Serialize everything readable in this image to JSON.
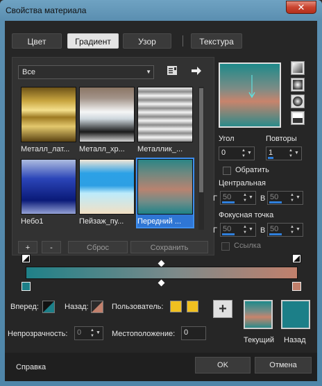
{
  "window": {
    "title": "Свойства материала",
    "close": "✕"
  },
  "tabs": [
    {
      "label": "Цвет",
      "active": false
    },
    {
      "label": "Градиент",
      "active": true
    },
    {
      "label": "Узор",
      "active": false
    },
    {
      "label": "Текстура",
      "active": false
    }
  ],
  "library": {
    "category": "Все",
    "items": [
      {
        "label": "Металл_лат...",
        "gradient": "linear-gradient(#6d5318,#c9a640 25%,#f4df8c 42%,#9d7a22 55%,#e3c86d 72%,#5b4312)",
        "selected": false
      },
      {
        "label": "Металл_хр...",
        "gradient": "linear-gradient(#8b7665,#a3948a 20%,#f5f6f6 45%,#cdd6dc 58%,#1a1a1a 82%,#d7d7d7)",
        "selected": false
      },
      {
        "label": "Металлик_...",
        "gradient": "repeating-linear-gradient(#f0f0f0 0,#8c8c8c 6px,#f6f6f6 12px)",
        "selected": false
      },
      {
        "label": "Небо1",
        "gradient": "linear-gradient(#aebde0,#2b45b8 35%,#0a1a78 75%,#95a2d6)",
        "selected": false
      },
      {
        "label": "Пейзаж_пу...",
        "gradient": "linear-gradient(#f3e6d6,#2ca1e6 25%,#2d9fe4 48%,#bcebfb 62%,#f2e0c4)",
        "selected": false
      },
      {
        "label": "Передний ...",
        "gradient": "linear-gradient(#2b8585,#6f8880 25%,#b88370 55%,#6e8c88 78%,#1f8388)",
        "selected": true
      }
    ],
    "add": "+",
    "remove": "-",
    "reset": "Сброс",
    "save": "Сохранить"
  },
  "preview": {
    "gradient": "linear-gradient(#1e8a8a,#7d8c86 40%,#c8846c 60%,#2a8a8a)"
  },
  "angle": {
    "label": "Угол",
    "value": "0"
  },
  "repeats": {
    "label": "Повторы",
    "value": "1"
  },
  "invert": {
    "label": "Обратить"
  },
  "center": {
    "label": "Центральная",
    "h_prefix": "Г",
    "h_value": "50",
    "v_prefix": "В",
    "v_value": "50"
  },
  "focal": {
    "label": "Фокусная точка",
    "h_prefix": "Г",
    "h_value": "50",
    "v_prefix": "В",
    "v_value": "50"
  },
  "link": {
    "label": "Ссылка"
  },
  "bottom": {
    "forward_label": "Вперед:",
    "back_label": "Назад:",
    "user_label": "Пользователь:",
    "opacity_label": "Непрозрачность:",
    "opacity_value": "0",
    "location_label": "Местоположение:",
    "location_value": "0",
    "user_color": "#f0c020",
    "current_label": "Текущий",
    "back_caption": "Назад",
    "back_color": "#1c7f88",
    "add_stop": "+"
  },
  "footer": {
    "help": "Справка",
    "ok": "OK",
    "cancel": "Отмена"
  },
  "colors": {
    "accent": "#2f7fdc"
  }
}
